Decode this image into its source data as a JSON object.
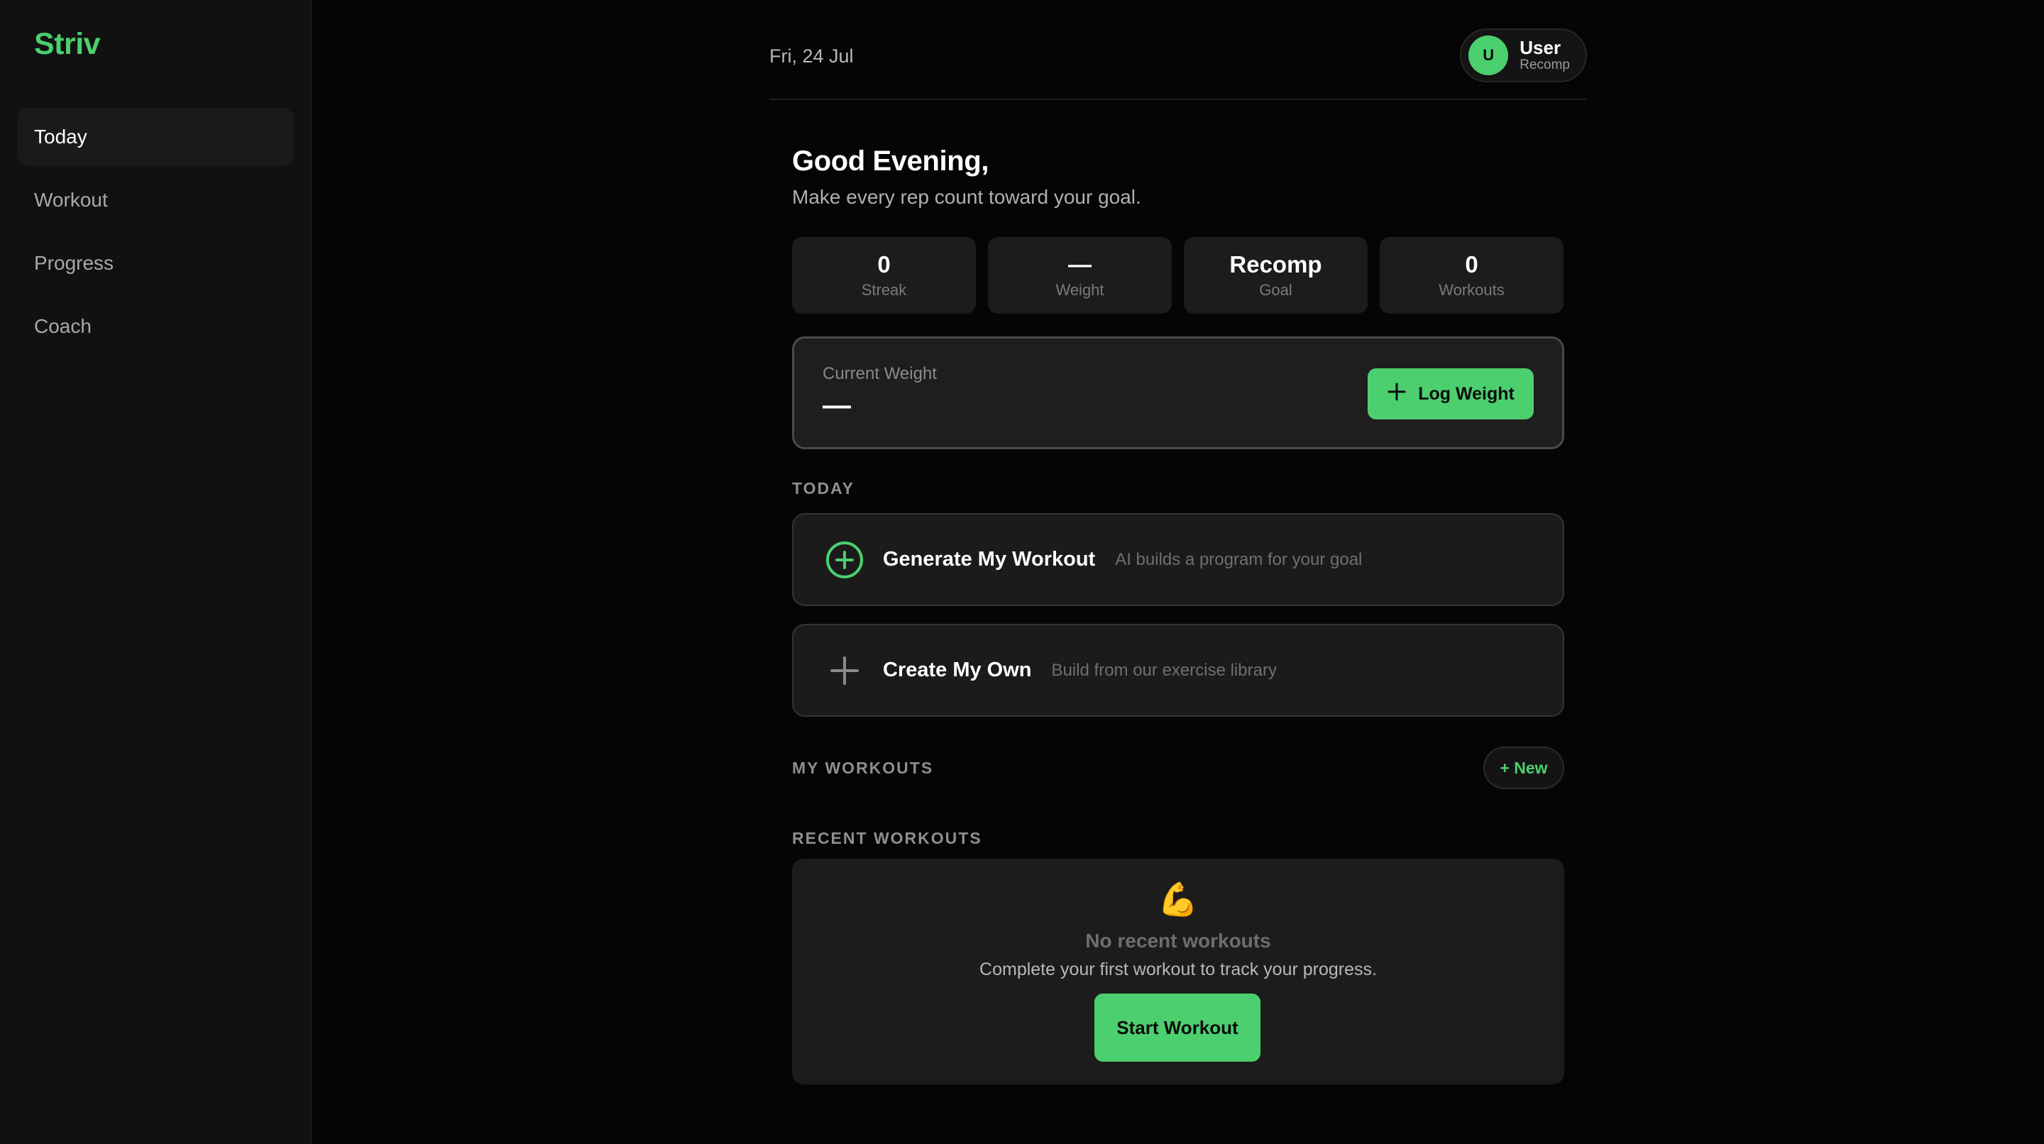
{
  "app": {
    "name": "Striv"
  },
  "colors": {
    "accent": "#4ccf6f",
    "background": "#050505",
    "sidebar": "#111111",
    "card": "#1c1c1c"
  },
  "sidebar": {
    "items": [
      {
        "label": "Today",
        "active": true
      },
      {
        "label": "Workout",
        "active": false
      },
      {
        "label": "Progress",
        "active": false
      },
      {
        "label": "Coach",
        "active": false
      }
    ]
  },
  "header": {
    "date": "Fri, 24 Jul",
    "user": {
      "initial": "U",
      "name": "User",
      "goal": "Recomp"
    }
  },
  "greeting": {
    "title": "Good Evening,",
    "subtitle": "Make every rep count toward your goal."
  },
  "stats": [
    {
      "value": "0",
      "label": "Streak"
    },
    {
      "value": "—",
      "label": "Weight"
    },
    {
      "value": "Recomp",
      "label": "Goal"
    },
    {
      "value": "0",
      "label": "Workouts"
    }
  ],
  "weight_card": {
    "label": "Current Weight",
    "value": "—",
    "button_label": "Log Weight",
    "button_icon": "plus-icon"
  },
  "today": {
    "section_title": "TODAY",
    "actions": [
      {
        "title": "Generate My Workout",
        "description": "AI builds a program for your goal",
        "icon": "plus-circle-icon"
      },
      {
        "title": "Create My Own",
        "description": "Build from our exercise library",
        "icon": "plus-icon"
      }
    ]
  },
  "my_workouts": {
    "section_title": "MY WORKOUTS",
    "new_button_label": "+ New"
  },
  "recent_workouts": {
    "section_title": "RECENT WORKOUTS",
    "empty_icon": "💪",
    "empty_title": "No recent workouts",
    "empty_description": "Complete your first workout to track your progress.",
    "button_label": "Start Workout"
  }
}
